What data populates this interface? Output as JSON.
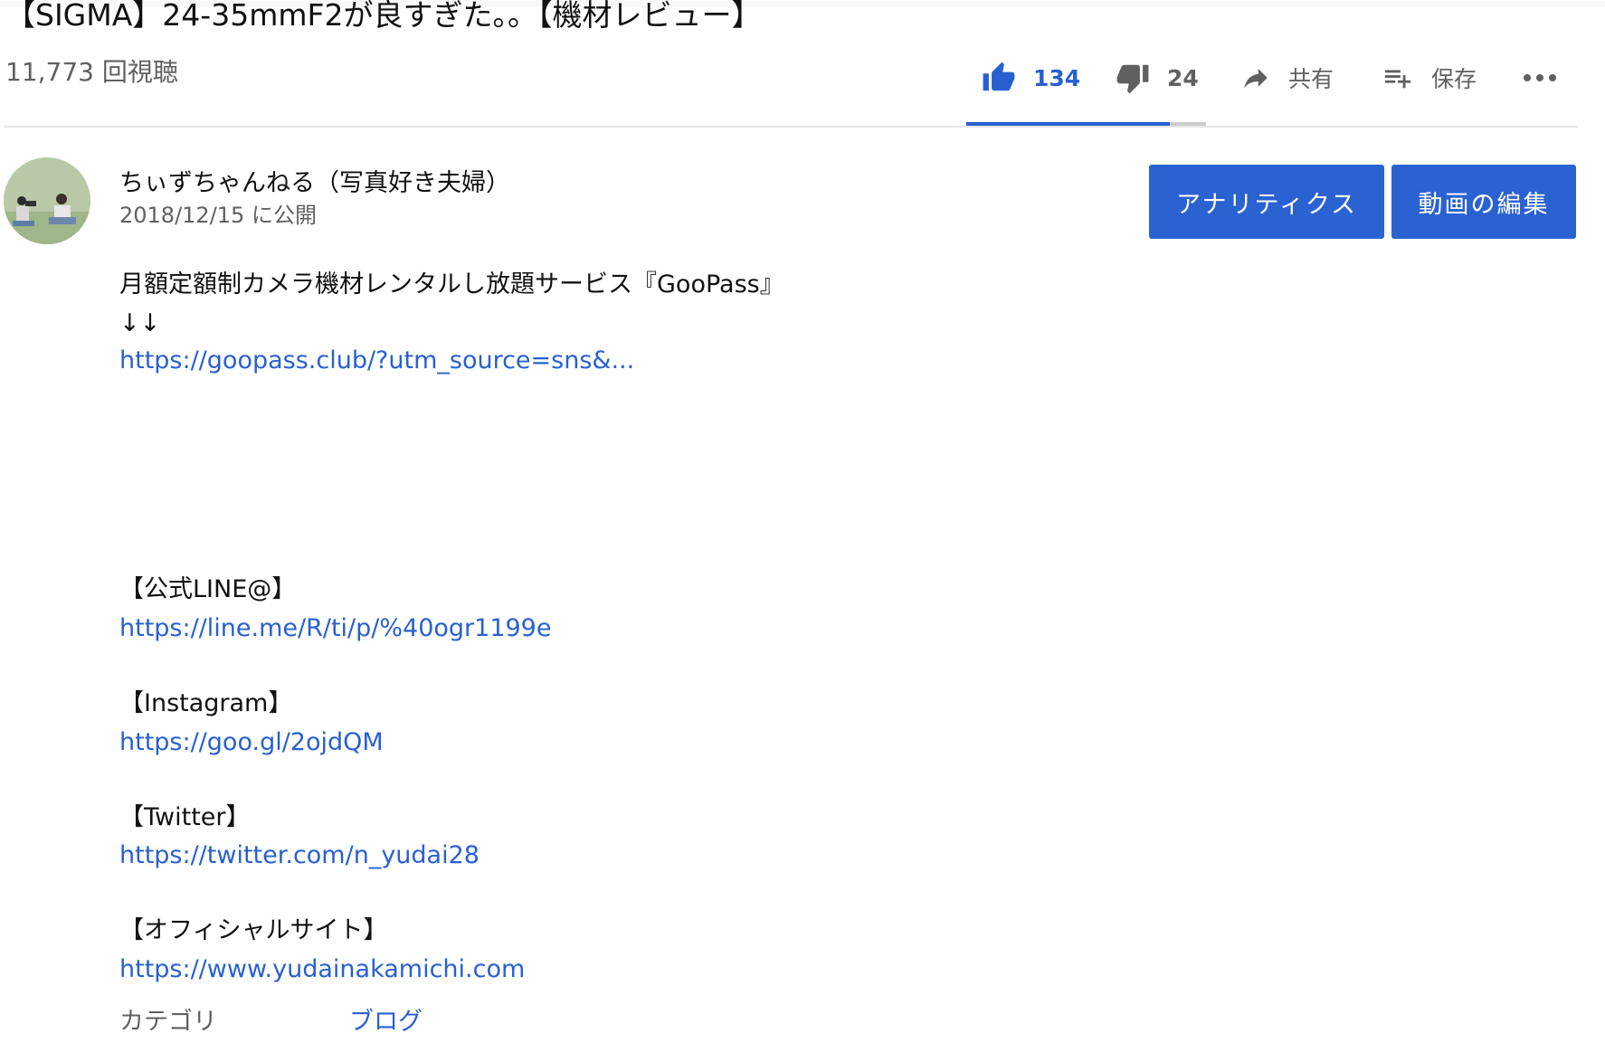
{
  "video": {
    "title": "【SIGMA】24-35mmF2が良すぎた。。【機材レビュー】",
    "views": "11,773 回視聴"
  },
  "actions": {
    "like_count": "134",
    "dislike_count": "24",
    "share_label": "共有",
    "save_label": "保存",
    "like_ratio": 0.848
  },
  "channel": {
    "name": "ちぃずちゃんねる（写真好き夫婦）",
    "published": "2018/12/15 に公開"
  },
  "buttons": {
    "analytics": "アナリティクス",
    "edit_video": "動画の編集"
  },
  "description": {
    "line1": "月額定額制カメラ機材レンタルし放題サービス『GooPass』",
    "arrows": "↓↓",
    "goopass_link": "https://goopass.club/?utm_source=sns&...",
    "line_heading": "【公式LINE@】",
    "line_link": "https://line.me/R/ti/p/%40ogr1199e",
    "instagram_heading": "【Instagram】",
    "instagram_link": "https://goo.gl/2ojdQM",
    "twitter_heading": "【Twitter】",
    "twitter_link": "https://twitter.com/n_yudai28",
    "site_heading": "【オフィシャルサイト】",
    "site_link": "https://www.yudainakamichi.com"
  },
  "category": {
    "label": "カテゴリ",
    "value": "ブログ"
  },
  "colors": {
    "accent": "#2860d2",
    "button": "#2b62d2",
    "secondary_text": "#606060"
  },
  "icons": [
    "thumbs-up-icon",
    "thumbs-down-icon",
    "share-arrow-icon",
    "playlist-add-icon",
    "more-dots-icon"
  ]
}
